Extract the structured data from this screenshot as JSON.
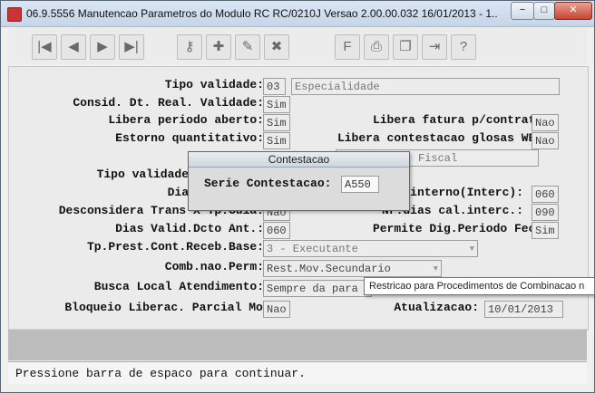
{
  "window": {
    "title": "06.9.5556 Manutencao  Parametros do Modulo RC RC/0210J Versao 2.00.00.032 16/01/2013 - 1...",
    "minimize": "−",
    "maximize": "□",
    "close": "✕"
  },
  "toolbar": {
    "buttons": [
      {
        "icon": "first-record-icon",
        "glyph": "|◀"
      },
      {
        "icon": "previous-record-icon",
        "glyph": "◀"
      },
      {
        "icon": "next-record-icon",
        "glyph": "▶"
      },
      {
        "icon": "last-record-icon",
        "glyph": "▶|"
      },
      {
        "icon": "search-key-icon",
        "glyph": "⚷"
      },
      {
        "icon": "add-record-icon",
        "glyph": "✚"
      },
      {
        "icon": "edit-record-icon",
        "glyph": "✎"
      },
      {
        "icon": "delete-record-icon",
        "glyph": "✖"
      },
      {
        "icon": "font-icon",
        "glyph": "F"
      },
      {
        "icon": "print-icon",
        "glyph": "⎙"
      },
      {
        "icon": "copy-pages-icon",
        "glyph": "❐"
      },
      {
        "icon": "exit-door-icon",
        "glyph": "⇥"
      },
      {
        "icon": "help-icon",
        "glyph": "?"
      }
    ]
  },
  "form": {
    "tipo_validade": {
      "label": "Tipo validade:",
      "code": "03",
      "desc": "Especialidade"
    },
    "consid_dt_real": {
      "label": "Consid. Dt. Real. Validade:",
      "value": "Sim"
    },
    "libera_periodo": {
      "label": "Libera periodo aberto:",
      "value": "Sim"
    },
    "libera_fatura": {
      "label": "Libera fatura p/contrat.:",
      "value": "Nao"
    },
    "estorno": {
      "label": "Estorno quantitativo:",
      "value": "Sim"
    },
    "libera_contestacao": {
      "label": "Libera contestacao glosas WEB:",
      "value": "Nao"
    },
    "ca_row": {
      "label": "Ca",
      "fiscal": "Fiscal"
    },
    "tipo_validade2": {
      "label": "Tipo validade"
    },
    "dia_row": {
      "label": "Dia",
      "interno_label": "interno(Interc):",
      "interno_value": "060"
    },
    "desconsidera": {
      "label": "Desconsidera Trans X Tp.Guia:",
      "value": "Nao",
      "nr_label": "Nr.dias cal.interc.:",
      "nr_value": "090"
    },
    "dias_valid": {
      "label": "Dias Valid.Dcto Ant.:",
      "value": "060",
      "permite_label": "Permite Dig.Periodo Fec.:",
      "permite_value": "Sim"
    },
    "tp_prest": {
      "label": "Tp.Prest.Cont.Receb.Base:",
      "value": "3 - Executante"
    },
    "comb_nao_perm": {
      "label": "Comb.nao.Perm:",
      "value": "Rest.Mov.Secundario"
    },
    "busca_local": {
      "label": "Busca Local Atendimento:",
      "value": "Sempre da para"
    },
    "bloqueio": {
      "label": "Bloqueio Liberac. Parcial Movto:",
      "value": "Nao",
      "atualizacao_label": "Atualizacao:",
      "atualizacao_value": "10/01/2013"
    }
  },
  "dialog": {
    "title": "Contestacao",
    "label": "Serie Contestacao:",
    "value": "A550"
  },
  "tooltip": {
    "text": "Restricao para Procedimentos de Combinacao n"
  },
  "status": {
    "text": "Pressione barra de espaco para continuar."
  }
}
